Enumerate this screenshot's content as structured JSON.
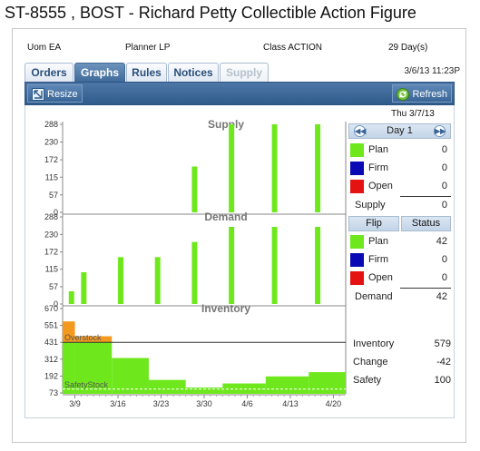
{
  "window": {
    "title": "ST-8555 , BOST - Richard Petty Collectible Action Figure"
  },
  "info": {
    "uom": "Uom EA",
    "planner": "Planner LP",
    "class": "Class ACTION",
    "days": "29 Day(s)"
  },
  "tabs": [
    {
      "label": "Orders",
      "state": "normal"
    },
    {
      "label": "Graphs",
      "state": "active"
    },
    {
      "label": "Rules",
      "state": "normal"
    },
    {
      "label": "Notices",
      "state": "normal"
    },
    {
      "label": "Supply",
      "state": "disabled"
    }
  ],
  "datetime": "3/6/13 11:23P",
  "toolbar": {
    "resize_label": "Resize",
    "refresh_label": "Refresh"
  },
  "colors": {
    "plan": "#6ee81c",
    "firm": "#0a0ab4",
    "open": "#e41212",
    "overstock": "#f39a1e",
    "toolbar": "#3a6697"
  },
  "side": {
    "date": "Thu 3/7/13",
    "day_label": "Day 1",
    "supply_rows": [
      {
        "label": "Plan",
        "value": "0",
        "color": "#6ee81c"
      },
      {
        "label": "Firm",
        "value": "0",
        "color": "#0a0ab4"
      },
      {
        "label": "Open",
        "value": "0",
        "color": "#e41212"
      }
    ],
    "supply_total": {
      "label": "Supply",
      "value": "0"
    },
    "flip_label": "Flip",
    "status_label": "Status",
    "demand_rows": [
      {
        "label": "Plan",
        "value": "42",
        "color": "#6ee81c"
      },
      {
        "label": "Firm",
        "value": "0",
        "color": "#0a0ab4"
      },
      {
        "label": "Open",
        "value": "0",
        "color": "#e41212"
      }
    ],
    "demand_total": {
      "label": "Demand",
      "value": "42"
    },
    "footer": [
      {
        "label": "Inventory",
        "value": "579"
      },
      {
        "label": "Change",
        "value": "-42"
      },
      {
        "label": "Safety",
        "value": "100"
      }
    ]
  },
  "chart_data": [
    {
      "type": "bar",
      "title": "Supply",
      "ylim": [
        0,
        288
      ],
      "yticks": [
        0,
        57,
        115,
        172,
        230,
        288
      ],
      "bars": [
        {
          "day": 21,
          "value": 150
        },
        {
          "day": 27,
          "value": 288
        },
        {
          "day": 34,
          "value": 288
        },
        {
          "day": 41,
          "value": 288
        }
      ]
    },
    {
      "type": "bar",
      "title": "Demand",
      "ylim": [
        0,
        288
      ],
      "yticks": [
        0,
        57,
        115,
        172,
        230,
        288
      ],
      "bars": [
        {
          "day": 1,
          "value": 42
        },
        {
          "day": 3,
          "value": 105
        },
        {
          "day": 9,
          "value": 155
        },
        {
          "day": 15,
          "value": 155
        },
        {
          "day": 21,
          "value": 205
        },
        {
          "day": 27,
          "value": 255
        },
        {
          "day": 34,
          "value": 255
        },
        {
          "day": 41,
          "value": 255
        }
      ]
    },
    {
      "type": "area",
      "title": "Inventory",
      "ylim": [
        73,
        670
      ],
      "yticks": [
        73,
        192,
        312,
        431,
        551,
        670
      ],
      "overstock": {
        "label": "Overstock",
        "value": 431
      },
      "safety": {
        "label": "SafetyStock",
        "value": 100
      },
      "steps": [
        {
          "from": 0,
          "to": 2,
          "value": 579
        },
        {
          "from": 2,
          "to": 8,
          "value": 474
        },
        {
          "from": 8,
          "to": 14,
          "value": 320
        },
        {
          "from": 14,
          "to": 20,
          "value": 165
        },
        {
          "from": 20,
          "to": 26,
          "value": 111
        },
        {
          "from": 26,
          "to": 33,
          "value": 140
        },
        {
          "from": 33,
          "to": 40,
          "value": 190
        },
        {
          "from": 40,
          "to": 46,
          "value": 220
        }
      ],
      "xticks": [
        "3/9",
        "3/16",
        "3/23",
        "3/30",
        "4/6",
        "4/13",
        "4/20"
      ]
    }
  ]
}
